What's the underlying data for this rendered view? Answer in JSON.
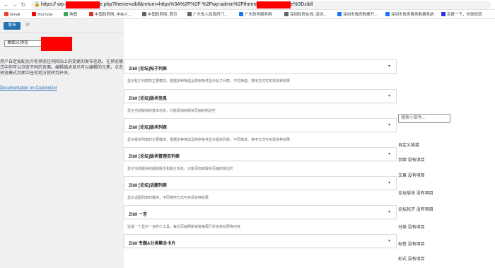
{
  "browser": {
    "url": "https://              wp-admin/customize.php?theme=zibll&return=https%3A%2F%2F            %2Fwp-admin%2Fthemes.php%3Ftheme%3Dzibll",
    "bookmarks": [
      "Gmail",
      "YouTube",
      "地图",
      "中国政府网_中央人...",
      "中国政府网_首页",
      "广东省人民政府门...",
      "广东政务服务网",
      "深圳政府在线_深圳...",
      "深圳市政府数据开...",
      "深圳市政务服务数据系统",
      "百度一下，你就知道"
    ],
    "bookmark_colors": [
      "#ea4335",
      "#ff0000",
      "#34a853",
      "#d93025",
      "#5f6368",
      "#5f6368",
      "#1a73e8",
      "#5f6368",
      "#1a73e8",
      "#1a73e8",
      "#2932e1"
    ]
  },
  "sidebar": {
    "publish_label": "发布",
    "preview_select": "桌面义预览",
    "description": "用户自定如配允许你预览任何网站上的变更的发布信息。在预览模式中你可以浏览不同的页面。编辑描述显示可以编辑的元素。点击预览模式页面中任何地方就转到开关。",
    "doc_link": "Documentation on Customizer"
  },
  "panels": [
    {
      "title": "Zibll [论坛]帖子列表",
      "desc": "显示帖子列表的主要模块，根据多种筛选及排序条件显示帖子列表，不同筛选、排序方式可实现多种效果"
    },
    {
      "title": "Zibll [论坛]版块信息",
      "desc": "显示当前版块的基本信息，只能添加到版块页面的侧边栏"
    },
    {
      "title": "Zibll [论坛]版块列表",
      "desc": "显示版块列表的主要模块，根据多种筛选及排序条件显示版块列表，不同筛选、排序方式可实现多种效果"
    },
    {
      "title": "Zibll [论坛]版块管理员列表",
      "desc": "显示当前版块的超级版主和版主信息，只能添加到版块页面的侧边栏"
    },
    {
      "title": "Zibll [论坛]话题列表",
      "desc": "显示话题列表的模块，不同排序方式可实现多种效果"
    },
    {
      "title": "Zibll 一言",
      "desc": "这是一个显示一言的小工具，每次页面刷新或者每隔几秒会自动更换内容"
    },
    {
      "title": "Zibll 专题&分类聚合卡片",
      "desc": ""
    }
  ],
  "right": {
    "search_placeholder": "搜索小部件...",
    "labels": [
      "自定义链接",
      "页面 没有项目",
      "文章 没有项目",
      "论坛版块 没有项目",
      "论坛帖子 没有项目",
      "分类 没有项目",
      "标签 没有项目",
      "形式 没有项目"
    ]
  }
}
